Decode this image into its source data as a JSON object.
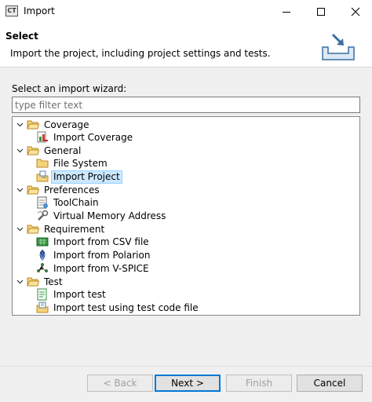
{
  "window": {
    "title": "Import",
    "app_icon_text": "CT"
  },
  "header": {
    "title": "Select",
    "description": "Import the project, including project settings and tests.",
    "icon": "import-tray-icon"
  },
  "wizard": {
    "label": "Select an import wizard:",
    "filter_placeholder": "type filter text",
    "filter_value": ""
  },
  "tree": {
    "categories": [
      {
        "label": "Coverage",
        "expanded": true,
        "children": [
          {
            "label": "Import Coverage",
            "icon": "coverage-icon"
          }
        ]
      },
      {
        "label": "General",
        "expanded": true,
        "children": [
          {
            "label": "File System",
            "icon": "folder-icon"
          },
          {
            "label": "Import Project",
            "icon": "project-icon",
            "selected": true
          }
        ]
      },
      {
        "label": "Preferences",
        "expanded": true,
        "children": [
          {
            "label": "ToolChain",
            "icon": "toolchain-icon"
          },
          {
            "label": "Virtual Memory Address",
            "icon": "wrench-icon"
          }
        ]
      },
      {
        "label": "Requirement",
        "expanded": true,
        "children": [
          {
            "label": "Import from CSV file",
            "icon": "csv-icon"
          },
          {
            "label": "Import from Polarion",
            "icon": "polarion-icon"
          },
          {
            "label": "Import from V-SPICE",
            "icon": "vspice-icon"
          }
        ]
      },
      {
        "label": "Test",
        "expanded": true,
        "children": [
          {
            "label": "Import test",
            "icon": "test-icon"
          },
          {
            "label": "Import test using test code file",
            "icon": "test-code-icon"
          }
        ]
      }
    ]
  },
  "buttons": {
    "back": "< Back",
    "next": "Next >",
    "finish": "Finish",
    "cancel": "Cancel"
  },
  "colors": {
    "selection_bg": "#cce8ff",
    "selection_border": "#99d1ff",
    "folder": "#e8b84a",
    "default_button_border": "#0078d7"
  }
}
